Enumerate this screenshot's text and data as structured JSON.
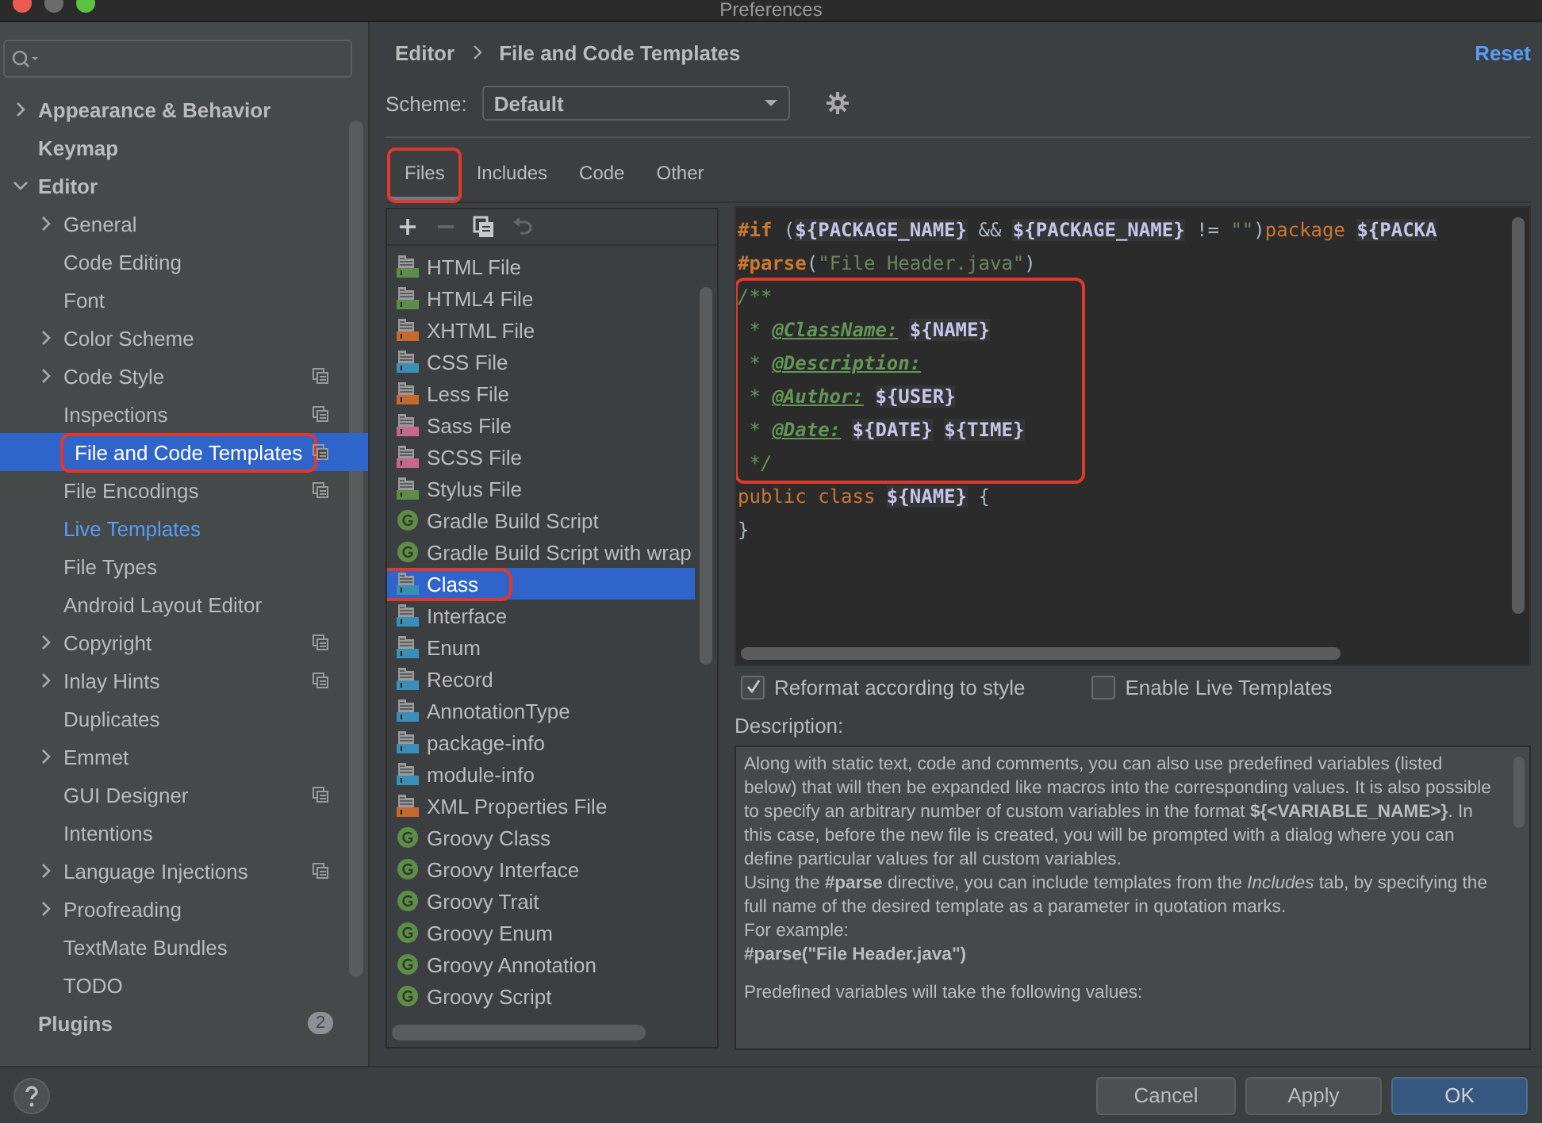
{
  "window": {
    "title": "Preferences"
  },
  "sidebar": {
    "items": [
      {
        "label": "Appearance & Behavior",
        "expanded": false,
        "selected": false
      },
      {
        "label": "Keymap",
        "selected": false
      },
      {
        "label": "Editor",
        "expanded": true,
        "selected": false,
        "children": [
          {
            "label": "General",
            "expanded": false,
            "selected": false
          },
          {
            "label": "Code Editing",
            "selected": false
          },
          {
            "label": "Font",
            "selected": false
          },
          {
            "label": "Color Scheme",
            "expanded": false,
            "selected": false
          },
          {
            "label": "Code Style",
            "expanded": false,
            "selected": false,
            "project_icon": true
          },
          {
            "label": "Inspections",
            "selected": false,
            "project_icon": true
          },
          {
            "label": "File and Code Templates",
            "selected": true,
            "highlighted": true,
            "project_icon": true
          },
          {
            "label": "File Encodings",
            "selected": false,
            "project_icon": true
          },
          {
            "label": "Live Templates",
            "selected": false,
            "link": true
          },
          {
            "label": "File Types",
            "selected": false
          },
          {
            "label": "Android Layout Editor",
            "selected": false
          },
          {
            "label": "Copyright",
            "expanded": false,
            "selected": false,
            "project_icon": true
          },
          {
            "label": "Inlay Hints",
            "expanded": false,
            "selected": false,
            "project_icon": true
          },
          {
            "label": "Duplicates",
            "selected": false
          },
          {
            "label": "Emmet",
            "expanded": false,
            "selected": false
          },
          {
            "label": "GUI Designer",
            "selected": false,
            "project_icon": true
          },
          {
            "label": "Intentions",
            "selected": false
          },
          {
            "label": "Language Injections",
            "expanded": false,
            "selected": false,
            "project_icon": true
          },
          {
            "label": "Proofreading",
            "expanded": false,
            "selected": false
          },
          {
            "label": "TextMate Bundles",
            "selected": false
          },
          {
            "label": "TODO",
            "selected": false
          }
        ]
      },
      {
        "label": "Plugins",
        "selected": false,
        "badge": "2"
      }
    ]
  },
  "header": {
    "breadcrumb": [
      "Editor",
      "File and Code Templates"
    ],
    "reset": "Reset"
  },
  "scheme": {
    "label": "Scheme:",
    "value": "Default"
  },
  "tabs": [
    {
      "label": "Files",
      "selected": true,
      "highlighted": true
    },
    {
      "label": "Includes",
      "selected": false
    },
    {
      "label": "Code",
      "selected": false
    },
    {
      "label": "Other",
      "selected": false
    }
  ],
  "templates": [
    {
      "name": "HTML File",
      "kind": "file",
      "color": "#5f8c48",
      "selected": false
    },
    {
      "name": "HTML4 File",
      "kind": "file",
      "color": "#5f8c48",
      "selected": false
    },
    {
      "name": "XHTML File",
      "kind": "file",
      "color": "#c5692f",
      "selected": false
    },
    {
      "name": "CSS File",
      "kind": "file",
      "color": "#3a8fb7",
      "selected": false
    },
    {
      "name": "Less File",
      "kind": "file",
      "color": "#c5692f",
      "selected": false
    },
    {
      "name": "Sass File",
      "kind": "file",
      "color": "#c4698a",
      "selected": false
    },
    {
      "name": "SCSS File",
      "kind": "file",
      "color": "#c4698a",
      "selected": false
    },
    {
      "name": "Stylus File",
      "kind": "file",
      "color": "#5f8c48",
      "selected": false
    },
    {
      "name": "Gradle Build Script",
      "kind": "groovy",
      "color": "#5f8c48",
      "selected": false
    },
    {
      "name": "Gradle Build Script with wrap",
      "kind": "groovy",
      "color": "#5f8c48",
      "selected": false
    },
    {
      "name": "Class",
      "kind": "file",
      "color": "#3a8fb7",
      "selected": true,
      "highlighted": true
    },
    {
      "name": "Interface",
      "kind": "file",
      "color": "#3a8fb7",
      "selected": false
    },
    {
      "name": "Enum",
      "kind": "file",
      "color": "#3a8fb7",
      "selected": false
    },
    {
      "name": "Record",
      "kind": "file",
      "color": "#3a8fb7",
      "selected": false
    },
    {
      "name": "AnnotationType",
      "kind": "file",
      "color": "#3a8fb7",
      "selected": false
    },
    {
      "name": "package-info",
      "kind": "file",
      "color": "#3a8fb7",
      "selected": false
    },
    {
      "name": "module-info",
      "kind": "file",
      "color": "#3a8fb7",
      "selected": false
    },
    {
      "name": "XML Properties File",
      "kind": "file",
      "color": "#c5692f",
      "selected": false
    },
    {
      "name": "Groovy Class",
      "kind": "groovy",
      "color": "#5f8c48",
      "selected": false
    },
    {
      "name": "Groovy Interface",
      "kind": "groovy",
      "color": "#5f8c48",
      "selected": false
    },
    {
      "name": "Groovy Trait",
      "kind": "groovy",
      "color": "#5f8c48",
      "selected": false
    },
    {
      "name": "Groovy Enum",
      "kind": "groovy",
      "color": "#5f8c48",
      "selected": false
    },
    {
      "name": "Groovy Annotation",
      "kind": "groovy",
      "color": "#5f8c48",
      "selected": false
    },
    {
      "name": "Groovy Script",
      "kind": "groovy",
      "color": "#5f8c48",
      "selected": false
    }
  ],
  "code": {
    "sections": [
      {
        "lines": [
          [
            {
              "kind": "directive",
              "text": "#if"
            },
            {
              "kind": "plain",
              "text": " ("
            },
            {
              "kind": "var",
              "text": "${PACKAGE_NAME}"
            },
            {
              "kind": "plain",
              "text": " && "
            },
            {
              "kind": "var",
              "text": "${PACKAGE_NAME}"
            },
            {
              "kind": "plain",
              "text": " != "
            },
            {
              "kind": "string",
              "text": "\"\""
            },
            {
              "kind": "plain",
              "text": ")"
            },
            {
              "kind": "keyword",
              "text": "package "
            },
            {
              "kind": "var",
              "text": "${PACKA"
            }
          ],
          [
            {
              "kind": "directive",
              "text": "#parse"
            },
            {
              "kind": "plain",
              "text": "("
            },
            {
              "kind": "string",
              "text": "\"File Header.java\""
            },
            {
              "kind": "plain",
              "text": ")"
            }
          ]
        ]
      },
      {
        "highlighted": true,
        "lines": [
          [
            {
              "kind": "comment",
              "text": "/**"
            }
          ],
          [
            {
              "kind": "comment",
              "text": " * "
            },
            {
              "kind": "tag",
              "text": "@ClassName:"
            },
            {
              "kind": "var",
              "text": " ${NAME}"
            }
          ],
          [
            {
              "kind": "comment",
              "text": " * "
            },
            {
              "kind": "tag",
              "text": "@Description:"
            }
          ],
          [
            {
              "kind": "comment",
              "text": " * "
            },
            {
              "kind": "tag",
              "text": "@Author:"
            },
            {
              "kind": "var",
              "text": " ${USER}"
            }
          ],
          [
            {
              "kind": "comment",
              "text": " * "
            },
            {
              "kind": "tag",
              "text": "@Date:"
            },
            {
              "kind": "var",
              "text": " ${DATE}"
            },
            {
              "kind": "var",
              "text": " ${TIME}"
            }
          ],
          [
            {
              "kind": "comment",
              "text": " */"
            }
          ]
        ]
      },
      {
        "lines": [
          [
            {
              "kind": "keyword",
              "text": "public class "
            },
            {
              "kind": "var",
              "text": "${NAME}"
            },
            {
              "kind": "plain",
              "text": " {"
            }
          ],
          [
            {
              "kind": "plain",
              "text": "}"
            }
          ]
        ]
      }
    ]
  },
  "options": [
    {
      "label": "Reformat according to style",
      "checked": true
    },
    {
      "label": "Enable Live Templates",
      "checked": false
    }
  ],
  "description": {
    "label": "Description:",
    "paragraphs": [
      "Along with static text, code and comments, you can also use predefined variables (listed below) that will then be expanded like macros into the corresponding values. It is also possible to specify an arbitrary number of custom variables in the format **${<VARIABLE_NAME>}**. In this case, before the new file is created, you will be prompted with a dialog where you can define particular values for all custom variables.",
      "Using the **#parse** directive, you can include templates from the *Includes* tab, by specifying the full name of the desired template as a parameter in quotation marks.",
      "For example:",
      "**#parse(\"File Header.java\")**",
      "Predefined variables will take the following values:"
    ]
  },
  "buttons": [
    {
      "label": "Cancel"
    },
    {
      "label": "Apply"
    },
    {
      "label": "OK",
      "default": true
    }
  ]
}
